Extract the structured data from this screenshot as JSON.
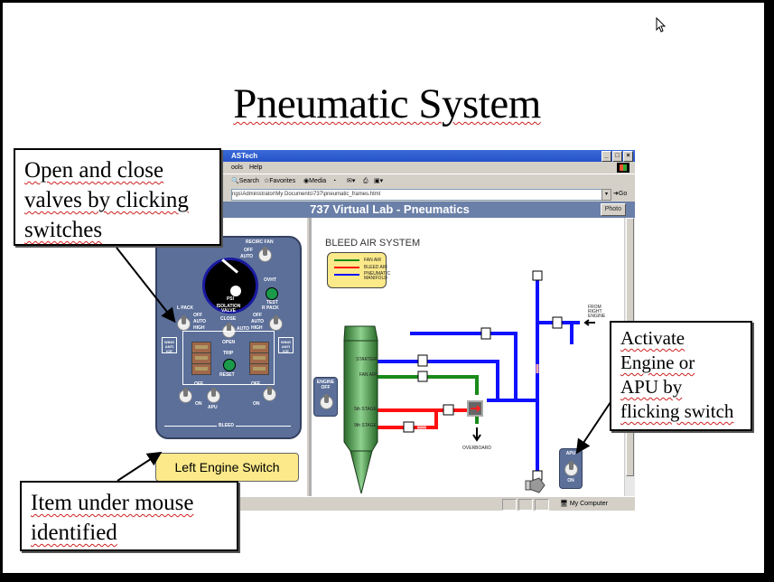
{
  "slide": {
    "title": "Pneumatic System"
  },
  "browser": {
    "window_title": "ASTech",
    "window_buttons": [
      "_",
      "□",
      "×"
    ],
    "menu": [
      "ools",
      "Help"
    ],
    "toolbar": [
      "Search",
      "Favorites",
      "Media"
    ],
    "address": "ngs\\Administrator\\My Documents\\737\\pneumatic_frames.html",
    "go_label": "Go",
    "status_zone": "My Computer"
  },
  "app": {
    "header_title": "737 Virtual Lab - Pneumatics",
    "photo_button": "Photo",
    "hover_label": "Left Engine Switch",
    "overhead_panel": {
      "recirc_fan": "RECIRC FAN",
      "recirc_off": "OFF",
      "recirc_auto": "AUTO",
      "gauge_unit": "PSI",
      "ovht": "OVHT",
      "test": "TEST",
      "l_pack": "L PACK",
      "r_pack": "R PACK",
      "pack_off": "OFF",
      "pack_auto": "AUTO",
      "pack_high": "HIGH",
      "isolation_valve": "ISOLATION VALVE",
      "iso_close": "CLOSE",
      "iso_auto": "AUTO",
      "iso_open": "OPEN",
      "wing_anti_ice": "WING ANTI ICE",
      "trip": "TRIP",
      "reset": "RESET",
      "bleed_off": "OFF",
      "bleed_on": "ON",
      "apu": "APU",
      "bleed": "BLEED"
    },
    "diagram": {
      "title": "BLEED AIR SYSTEM",
      "legend": [
        {
          "label": "FAN AIR",
          "color": "#1a8a1a"
        },
        {
          "label": "BLEED AIR",
          "color": "#ff1010"
        },
        {
          "label": "PNEUMATIC MANIFOLD",
          "color": "#1010ff"
        }
      ],
      "engine_ports": [
        "STARTER",
        "FAN AIR",
        "5th STAGE",
        "9th STAGE"
      ],
      "overboard": "OVERBOARD",
      "from_right_engine": "FROM RIGHT ENGINE",
      "engine_switch": {
        "label": "ENGINE",
        "state": "OFF"
      },
      "apu_switch": {
        "label": "APU",
        "state": "ON"
      }
    }
  },
  "callouts": {
    "valves": [
      "Open and close",
      "valves by clicking",
      "switches"
    ],
    "mouse": [
      "Item under mouse",
      "identified"
    ],
    "engine": [
      "Activate",
      "Engine or",
      "APU by",
      "flicking switch"
    ]
  }
}
